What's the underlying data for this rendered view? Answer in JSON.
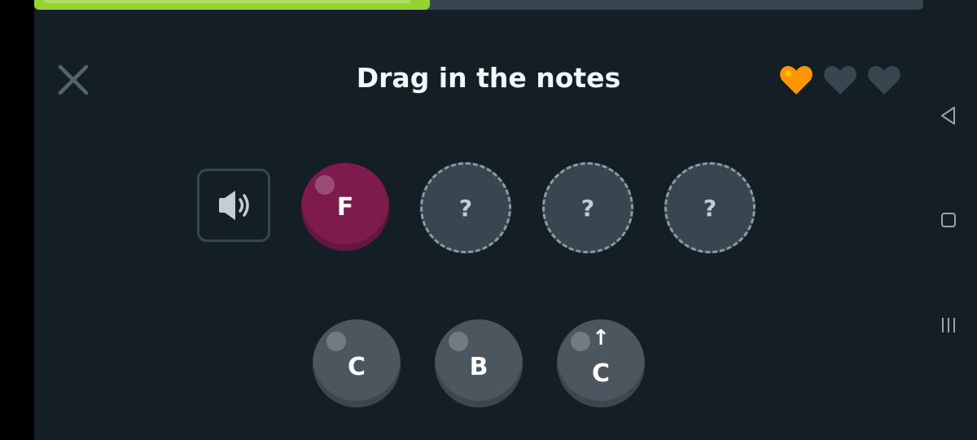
{
  "progress": {
    "fraction": 0.445,
    "fill_color": "#93d333",
    "track_color": "#37464f"
  },
  "header": {
    "title": "Drag in the notes",
    "close_icon": "close-icon",
    "hearts": [
      {
        "state": "filled",
        "color": "#ff9600"
      },
      {
        "state": "empty",
        "color": "#37464f"
      },
      {
        "state": "empty",
        "color": "#37464f"
      }
    ]
  },
  "answer_row": {
    "speaker_icon": "speaker-icon",
    "placed_note": {
      "label": "F",
      "color": "#7d1b4c"
    },
    "slots": [
      {
        "label": "?"
      },
      {
        "label": "?"
      },
      {
        "label": "?"
      }
    ]
  },
  "note_bank": [
    {
      "label": "C",
      "octave_up": false
    },
    {
      "label": "B",
      "octave_up": false
    },
    {
      "label": "C",
      "octave_up": true
    }
  ],
  "system_nav": [
    "back-icon",
    "home-icon",
    "recents-icon"
  ]
}
